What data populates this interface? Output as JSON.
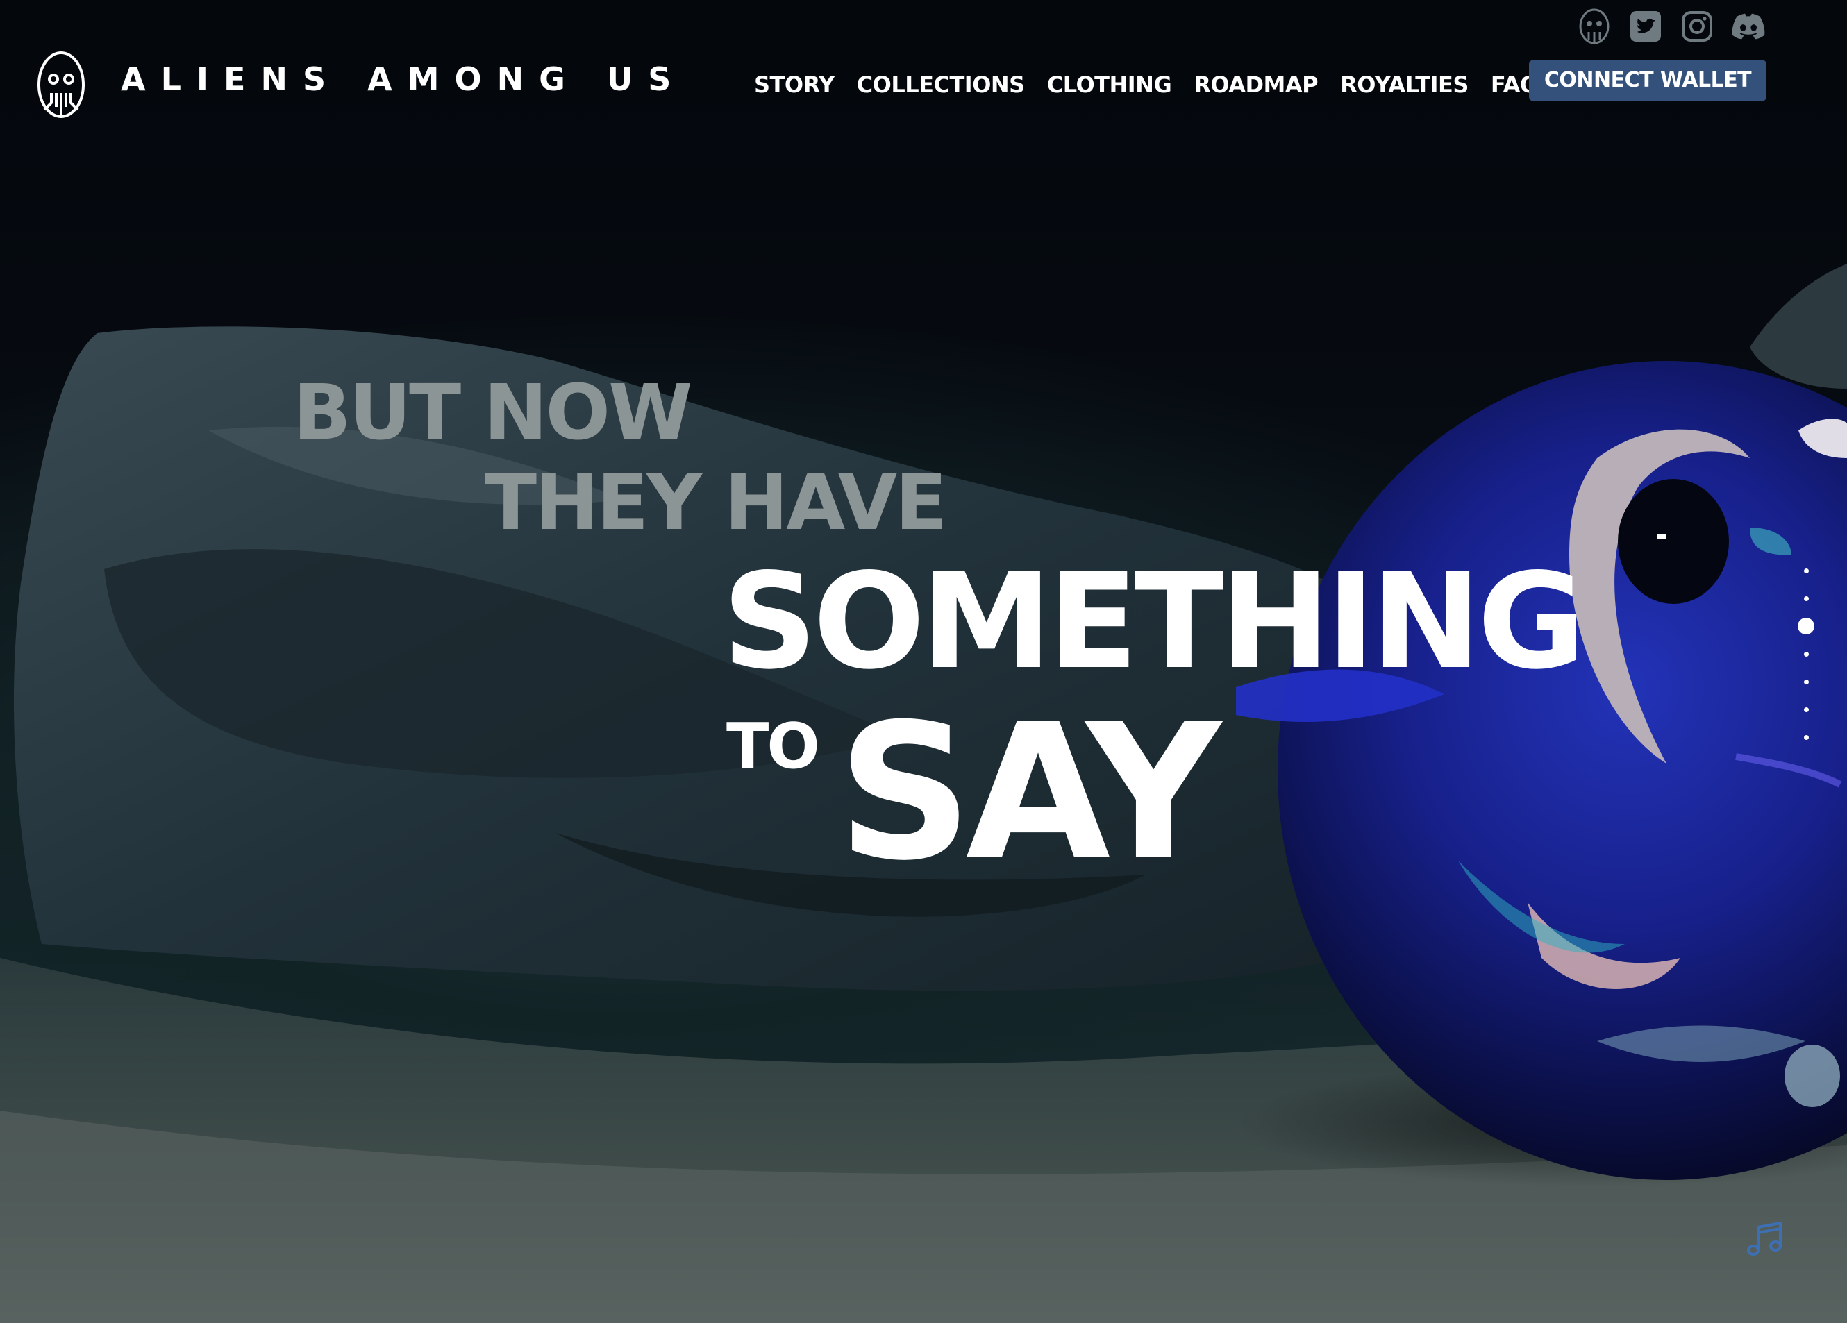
{
  "header": {
    "brand": "ALIENS AMONG US",
    "nav": [
      "STORY",
      "COLLECTIONS",
      "CLOTHING",
      "ROADMAP",
      "ROYALTIES",
      "FAQ"
    ],
    "connect_label": "CONNECT WALLET",
    "social": [
      "alien-logo-icon",
      "twitter-icon",
      "instagram-icon",
      "discord-icon"
    ]
  },
  "hero": {
    "line1": "BUT NOW",
    "line2": "THEY HAVE",
    "line3": "SOMETHING",
    "line4_small": "TO",
    "line4_large": "SAY"
  },
  "scroll_indicator": {
    "count": 7,
    "active_index": 2
  },
  "colors": {
    "accent_button": "#33517a",
    "muted_text": "#8c9596",
    "music_icon": "#3d6fb4"
  }
}
